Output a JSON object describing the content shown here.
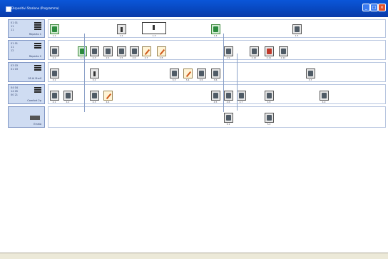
{
  "window": {
    "title": "Dispositivi Stazione (Programma)",
    "min_label": "_",
    "max_label": "□",
    "close_label": "×"
  },
  "rows": [
    {
      "id": "row-1",
      "numbers": [
        "01 01",
        "11",
        "11"
      ],
      "name": "Reparto 1"
    },
    {
      "id": "row-2",
      "numbers": [
        "01 01",
        "11",
        "12"
      ],
      "name": "Reparto 2"
    },
    {
      "id": "row-3",
      "numbers": [
        "03 03",
        "01 03"
      ],
      "name": "18 Al Shelf"
    },
    {
      "id": "row-4",
      "numbers": [
        "04 04",
        "14 05",
        "00 21"
      ],
      "name": "Comfort 2p"
    },
    {
      "id": "row-5",
      "numbers": [],
      "name": "Errata"
    }
  ],
  "modules": {
    "r1": [
      {
        "label": "1.1",
        "kind": "green"
      },
      {
        "label": "1.2",
        "kind": "gray"
      },
      {
        "label": "1.3",
        "kind": "selected"
      },
      {
        "label": "1.4",
        "kind": "green"
      },
      {
        "label": "1.5",
        "kind": "gray"
      }
    ],
    "r2": [
      {
        "label": "2.1",
        "kind": "gray"
      },
      {
        "label": "2.2",
        "kind": "green"
      },
      {
        "label": "2.3",
        "kind": "gray"
      },
      {
        "label": "2.4",
        "kind": "gray"
      },
      {
        "label": "2.5",
        "kind": "gray"
      },
      {
        "label": "2.6",
        "kind": "gray"
      },
      {
        "label": "2.7",
        "kind": "cream"
      },
      {
        "label": "2.8",
        "kind": "cream"
      },
      {
        "label": "2.9",
        "kind": "gray"
      },
      {
        "label": "2.10",
        "kind": "gray"
      },
      {
        "label": "2.11",
        "kind": "gray"
      },
      {
        "label": "2.12",
        "kind": "gray"
      }
    ],
    "r3": [
      {
        "label": "3.1",
        "kind": "gray"
      },
      {
        "label": "3.2",
        "kind": "gray"
      },
      {
        "label": "3.3",
        "kind": "gray"
      },
      {
        "label": "3.4",
        "kind": "cream"
      },
      {
        "label": "3.5",
        "kind": "gray"
      },
      {
        "label": "3.6",
        "kind": "gray"
      },
      {
        "label": "3.7",
        "kind": "gray"
      }
    ],
    "r4": [
      {
        "label": "4.1",
        "kind": "gray"
      },
      {
        "label": "4.2",
        "kind": "gray"
      },
      {
        "label": "4.3",
        "kind": "gray"
      },
      {
        "label": "4.4",
        "kind": "cream"
      },
      {
        "label": "4.5",
        "kind": "gray"
      },
      {
        "label": "4.6",
        "kind": "gray"
      },
      {
        "label": "4.7",
        "kind": "gray"
      },
      {
        "label": "4.8",
        "kind": "gray"
      },
      {
        "label": "4.9",
        "kind": "gray"
      }
    ],
    "r5": [
      {
        "label": "5.1",
        "kind": "gray"
      },
      {
        "label": "5.2",
        "kind": "gray"
      }
    ]
  }
}
